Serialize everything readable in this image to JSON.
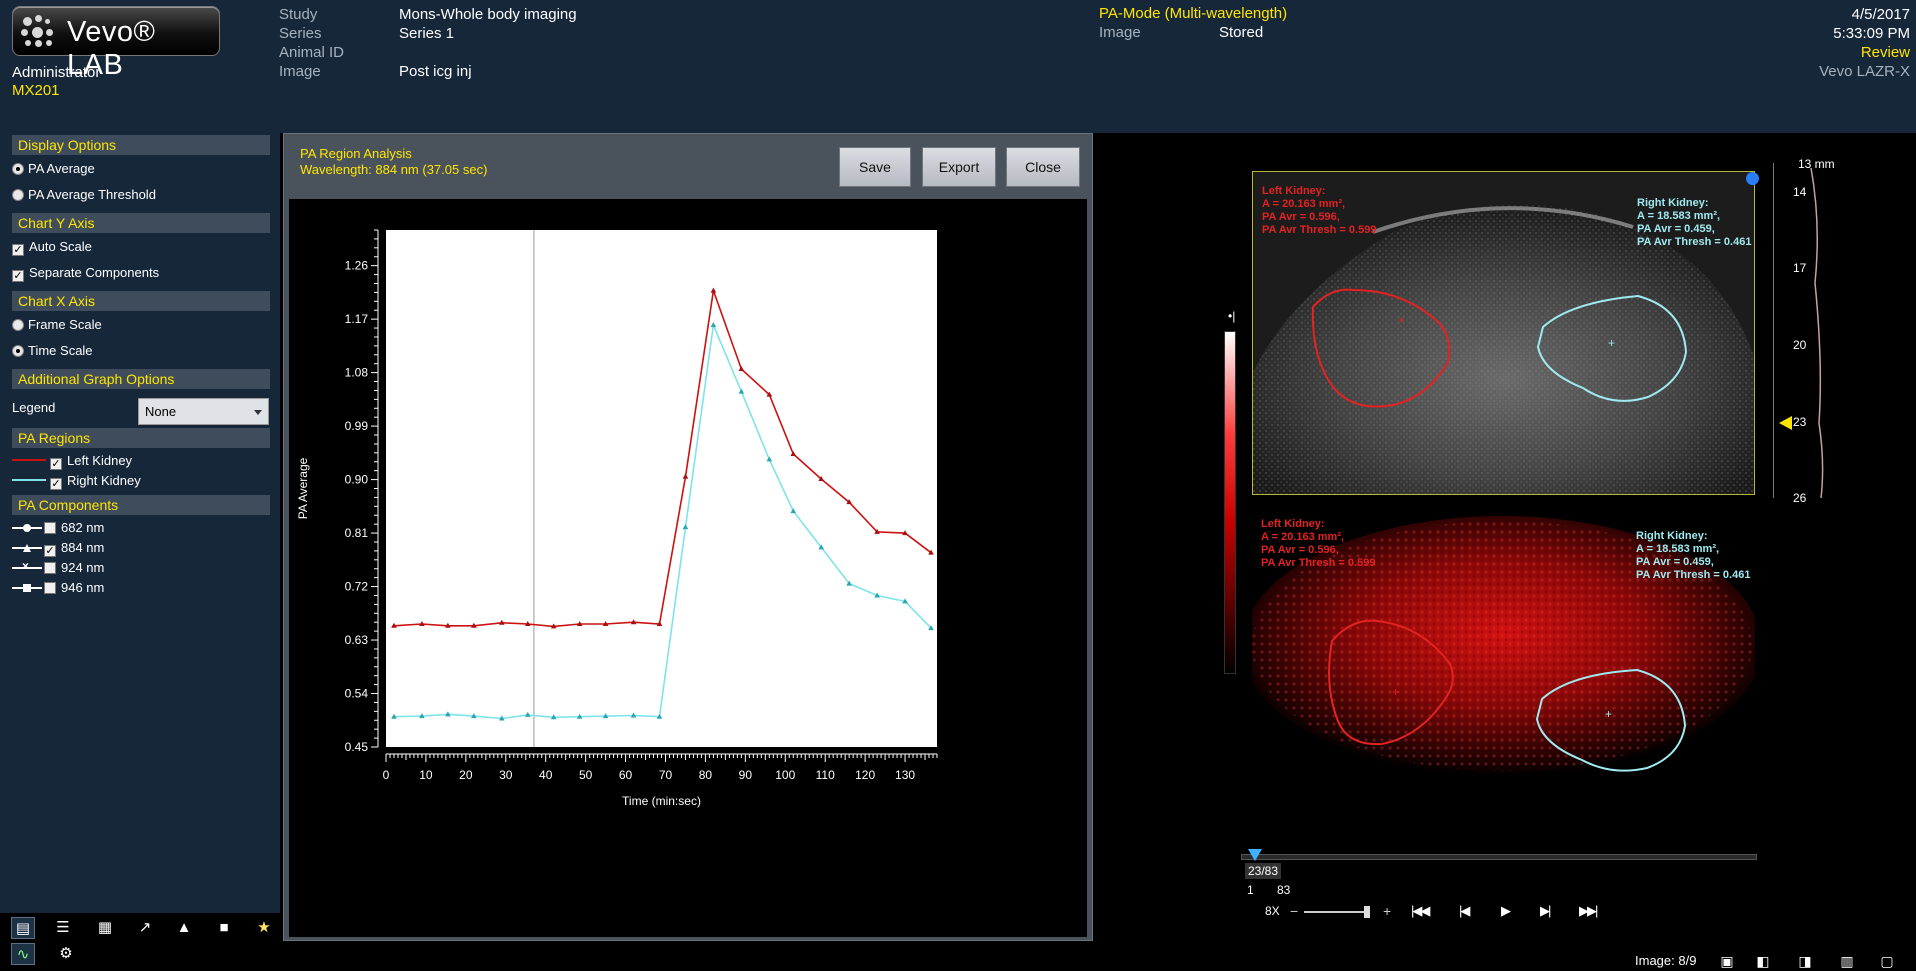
{
  "app": {
    "logo_text": "Vevo® LAB",
    "user": "Administrator",
    "user_code": "MX201"
  },
  "header": {
    "labels": [
      "Study",
      "Series",
      "Animal ID",
      "Image"
    ],
    "values": [
      "Mons-Whole body imaging",
      "Series 1",
      "",
      "Post icg inj"
    ],
    "mode_title": "PA-Mode (Multi-wavelength)",
    "mode_label": "Image",
    "mode_value": "Stored",
    "date": "4/5/2017",
    "time": "5:33:09 PM",
    "status": "Review",
    "system": "Vevo LAZR-X"
  },
  "sidebar": {
    "display_options": {
      "title": "Display Options",
      "items": [
        {
          "label": "PA Average",
          "selected": true
        },
        {
          "label": "PA Average Threshold",
          "selected": false
        }
      ]
    },
    "chart_y_axis": {
      "title": "Chart Y Axis",
      "items": [
        {
          "label": "Auto Scale",
          "checked": true
        },
        {
          "label": "Separate Components",
          "checked": true
        }
      ]
    },
    "chart_x_axis": {
      "title": "Chart X Axis",
      "items": [
        {
          "label": "Frame Scale",
          "selected": false
        },
        {
          "label": "Time Scale",
          "selected": true
        }
      ]
    },
    "additional": {
      "title": "Additional Graph Options",
      "legend_label": "Legend",
      "legend_value": "None"
    },
    "pa_regions": {
      "title": "PA Regions",
      "items": [
        {
          "label": "Left Kidney",
          "checked": true,
          "color": "#cc1111"
        },
        {
          "label": "Right Kidney",
          "checked": true,
          "color": "#7fe3ea"
        }
      ]
    },
    "pa_components": {
      "title": "PA Components",
      "items": [
        {
          "label": "682 nm",
          "checked": false,
          "marker": "circle"
        },
        {
          "label": "884 nm",
          "checked": true,
          "marker": "triangle"
        },
        {
          "label": "924 nm",
          "checked": false,
          "marker": "cross"
        },
        {
          "label": "946 nm",
          "checked": false,
          "marker": "square"
        }
      ]
    }
  },
  "panel": {
    "title": "PA Region Analysis",
    "subtitle": "Wavelength: 884 nm (37.05 sec)",
    "buttons": [
      "Save",
      "Export",
      "Close"
    ]
  },
  "chart_data": {
    "type": "line",
    "xlabel": "Time (min:sec)",
    "ylabel": "PA Average",
    "xlim": [
      0,
      138
    ],
    "ylim": [
      0.45,
      1.32
    ],
    "x_ticks": [
      0,
      10,
      20,
      30,
      40,
      50,
      60,
      70,
      80,
      90,
      100,
      110,
      120,
      130
    ],
    "y_ticks": [
      0.45,
      0.54,
      0.63,
      0.72,
      0.81,
      0.9,
      0.99,
      1.08,
      1.17,
      1.26
    ],
    "cursor_x": 37.05,
    "x": [
      2,
      9,
      15.5,
      22,
      29,
      35.5,
      42,
      48.5,
      55,
      62,
      68.5,
      75,
      82,
      89,
      96,
      102,
      109,
      116,
      123,
      130,
      136.5
    ],
    "series": [
      {
        "name": "Left Kidney",
        "color": "#cc1111",
        "values": [
          0.654,
          0.657,
          0.654,
          0.654,
          0.659,
          0.657,
          0.653,
          0.657,
          0.657,
          0.66,
          0.657,
          0.905,
          1.218,
          1.086,
          1.043,
          0.943,
          0.901,
          0.862,
          0.812,
          0.81,
          0.777
        ]
      },
      {
        "name": "Right Kidney",
        "color": "#7fe3ea",
        "values": [
          0.501,
          0.502,
          0.505,
          0.502,
          0.498,
          0.504,
          0.5,
          0.501,
          0.502,
          0.503,
          0.501,
          0.82,
          1.16,
          1.048,
          0.934,
          0.847,
          0.786,
          0.725,
          0.705,
          0.695,
          0.65
        ]
      }
    ]
  },
  "viewer": {
    "left_kidney": {
      "title": "Left Kidney:",
      "area": "A = 20.163 mm²,",
      "avr": "PA Avr = 0.596,",
      "thresh": "PA Avr Thresh = 0.599"
    },
    "right_kidney": {
      "title": "Right Kidney:",
      "area": "A = 18.583 mm²,",
      "avr": "PA Avr = 0.459,",
      "thresh": "PA Avr Thresh = 0.461"
    },
    "depth_top": "13 mm",
    "depth_labels": [
      "14",
      "17",
      "20",
      "23",
      "26"
    ],
    "scale_mark": "•|",
    "frame_current": "23/83",
    "frame_min": "1",
    "frame_max": "83",
    "zoom": "8X",
    "image_count": "Image: 8/9"
  }
}
